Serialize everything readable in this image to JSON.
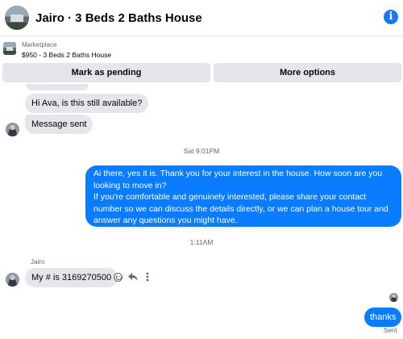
{
  "header": {
    "title": "Jairo · 3 Beds 2 Baths House",
    "info_icon": "i"
  },
  "listing": {
    "label": "Marketplace",
    "title": "$950 - 3 Beds 2 Baths House"
  },
  "actions": {
    "pending_label": "Mark as pending",
    "more_label": "More options"
  },
  "messages": [
    {
      "from": "them",
      "text": "Hi Ava, is this still available?"
    },
    {
      "from": "them",
      "text": "Message sent"
    },
    {
      "from": "me",
      "lines": [
        "Ai there, yes it is. Thank you for your interest in the house. How soon are you looking to move in?",
        "If you're comfortable and genuinely interested, please share your contact number so we can discuss the details directly, or we can plan a house tour and answer any questions you might have."
      ]
    },
    {
      "from": "them",
      "sender": "Jairo",
      "text": "My # is 3169270500"
    },
    {
      "from": "me",
      "text": "thanks",
      "status": "Sent"
    }
  ],
  "timestamps": [
    "Sat 9:01PM",
    "1:11AM"
  ],
  "colors": {
    "accent": "#0a7cff",
    "incoming_bubble": "#e4e6eb",
    "secondary_text": "#65676b"
  },
  "icons": [
    "house-thumbnail",
    "info-icon",
    "react-smile-icon",
    "reply-icon",
    "more-dots-icon"
  ]
}
